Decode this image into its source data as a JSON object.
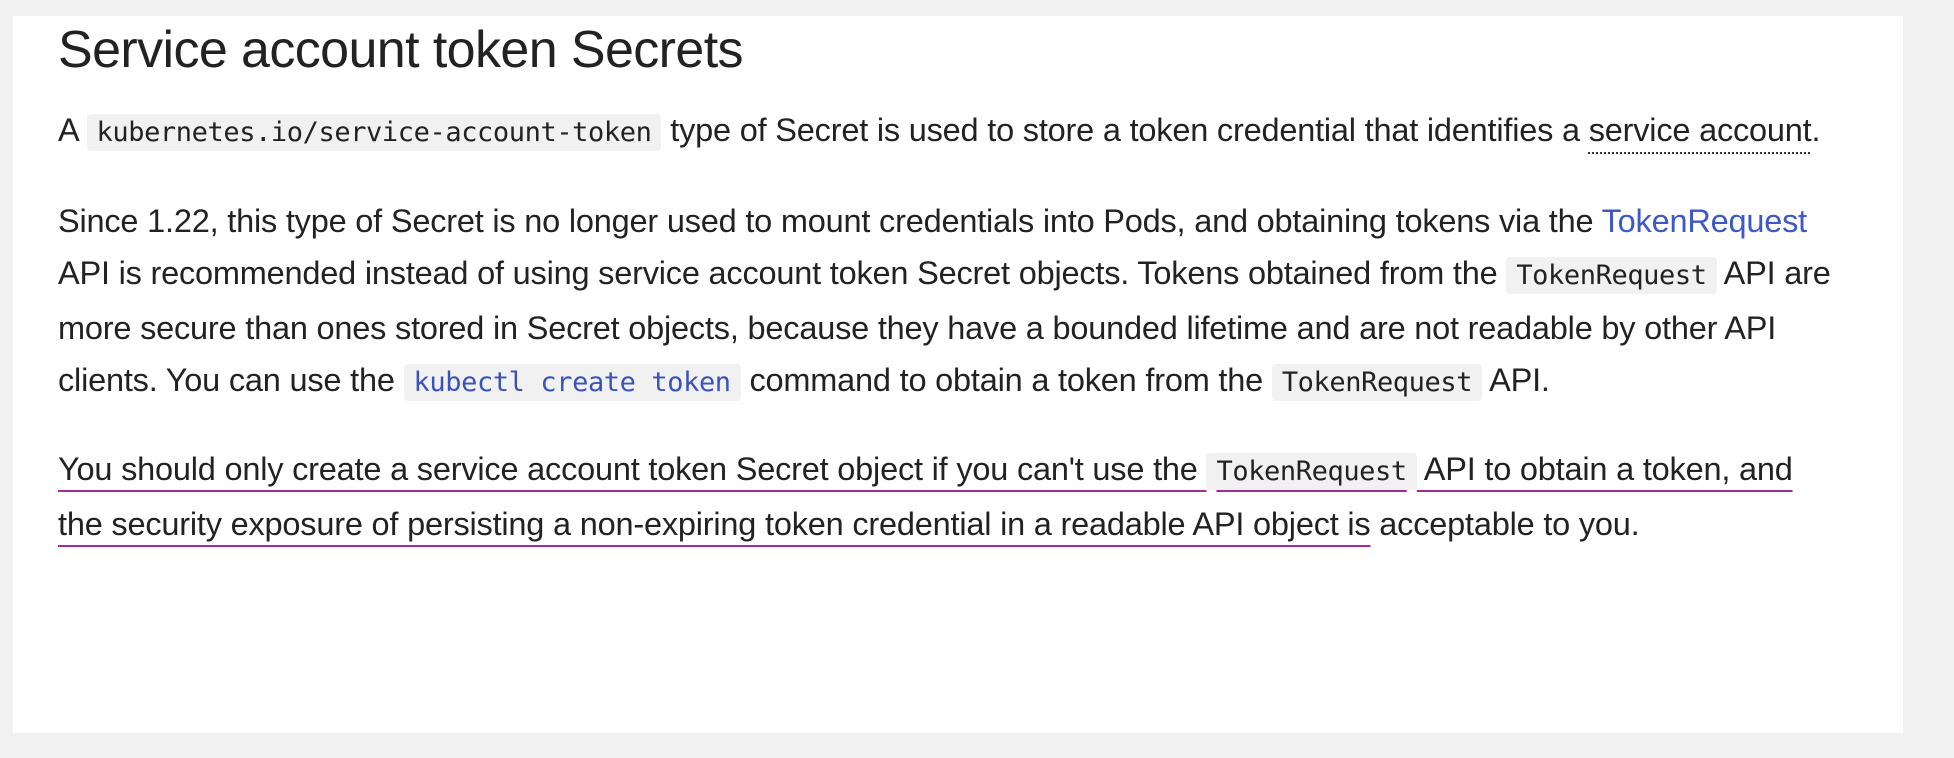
{
  "section": {
    "title": "Service account token Secrets"
  },
  "p1": {
    "t0": "A ",
    "code_secret_type": "kubernetes.io/service-account-token",
    "t1": " type of Secret is used to store a token credential that identifies a ",
    "glossary_term": "service account",
    "t2": "."
  },
  "p2": {
    "t0": "Since 1.22, this type of Secret is no longer used to mount credentials into Pods, and obtaining tokens via the ",
    "link_tokenrequest": "TokenRequest",
    "t1": " API is recommended instead of using service account token Secret objects. Tokens obtained from the ",
    "code_tokenrequest_1": "TokenRequest",
    "t2": " API are more secure than ones stored in Secret objects, because they have a bounded lifetime and are not readable by other API clients. You can use the ",
    "code_kubectl_link": "kubectl create token",
    "t3": " command to obtain a token from the ",
    "code_tokenrequest_2": "TokenRequest",
    "t4": " API."
  },
  "p3": {
    "t0": "You should only create a service account token Secret object if you can't use the ",
    "code_tokenrequest": "TokenRequest",
    "t1": " API to obtain a token, and the security exposure of persisting a non-expiring token credential in a readable API object is",
    "t2": " acceptable to you."
  },
  "colors": {
    "link": "#3d59c6",
    "highlight_underline": "#a42c9a",
    "code_background": "#f1f1f1",
    "text": "#222222"
  }
}
